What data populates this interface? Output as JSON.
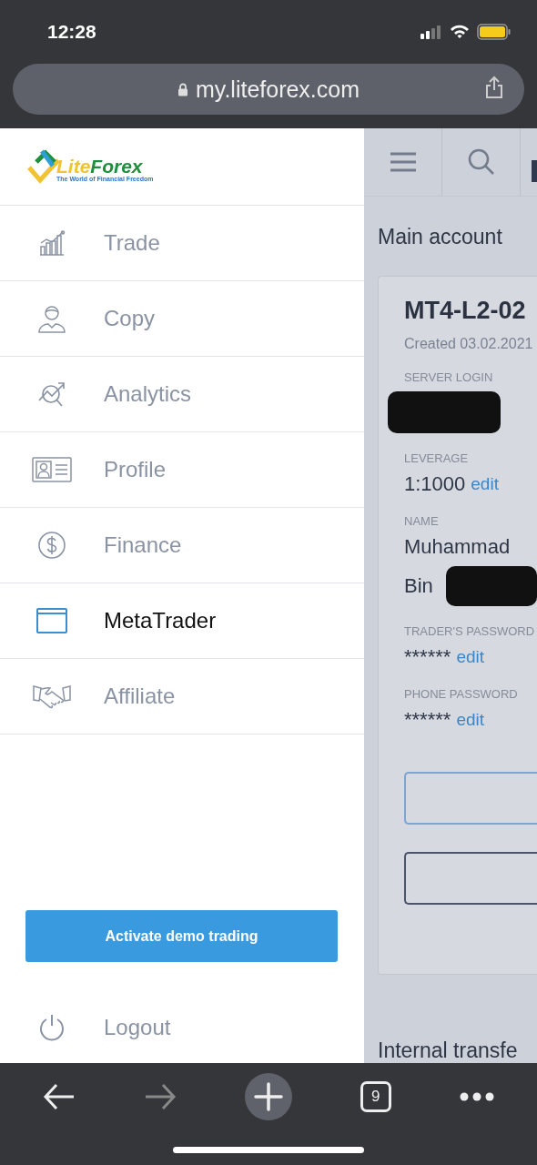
{
  "status_bar": {
    "time": "12:28"
  },
  "browser": {
    "url": "my.liteforex.com"
  },
  "logo": {
    "name": [
      "Lite",
      "Forex"
    ],
    "tagline": "The World of Financial Freedom"
  },
  "menu": [
    {
      "label": "Trade",
      "selected": false
    },
    {
      "label": "Copy",
      "selected": false
    },
    {
      "label": "Analytics",
      "selected": false
    },
    {
      "label": "Profile",
      "selected": false
    },
    {
      "label": "Finance",
      "selected": false
    },
    {
      "label": "MetaTrader",
      "selected": true
    },
    {
      "label": "Affiliate",
      "selected": false
    }
  ],
  "demo_button": "Activate demo trading",
  "logout": "Logout",
  "account": {
    "section_title": "Main account",
    "title": "MT4-L2-02",
    "created": "Created 03.02.2021",
    "fields": [
      {
        "label": "SERVER LOGIN",
        "redacted": true
      },
      {
        "label": "LEVERAGE",
        "value": "1:1000",
        "edit": "edit"
      },
      {
        "label": "NAME",
        "value": "Muhammad",
        "value_2": "Bin",
        "redacted": true
      },
      {
        "label": "TRADER'S PASSWORD",
        "value": "******",
        "edit": "edit"
      },
      {
        "label": "PHONE PASSWORD",
        "value": "******",
        "edit": "edit"
      }
    ],
    "next_section": "Internal transfe"
  },
  "toolbar": {
    "back_disabled": false,
    "forward_disabled": true,
    "tab_count": "9"
  }
}
